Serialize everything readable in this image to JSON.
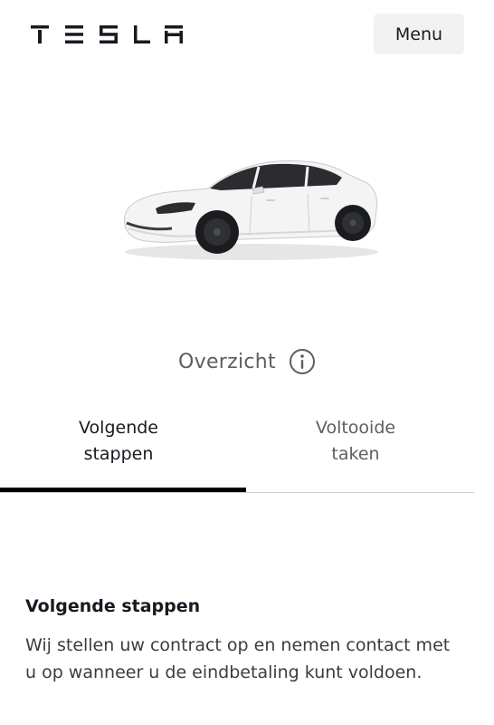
{
  "header": {
    "logo_text": "TESLA",
    "menu_label": "Menu"
  },
  "vehicle": {
    "image_icon": "car-white-model-3"
  },
  "overview": {
    "label": "Overzicht",
    "info_icon": "info-icon"
  },
  "tabs": [
    {
      "label": "Volgende stappen",
      "active": true
    },
    {
      "label": "Voltooide taken",
      "active": false
    }
  ],
  "section": {
    "title": "Volgende stappen",
    "body": "Wij stellen uw contract op en nemen contact met u op wanneer u de eindbetaling kunt voldoen."
  },
  "colors": {
    "text_primary": "#171a20",
    "text_secondary": "#5c5e62",
    "menu_bg": "#f2f2f2",
    "tab_indicator": "#000000",
    "divider": "#d0d1d2"
  }
}
